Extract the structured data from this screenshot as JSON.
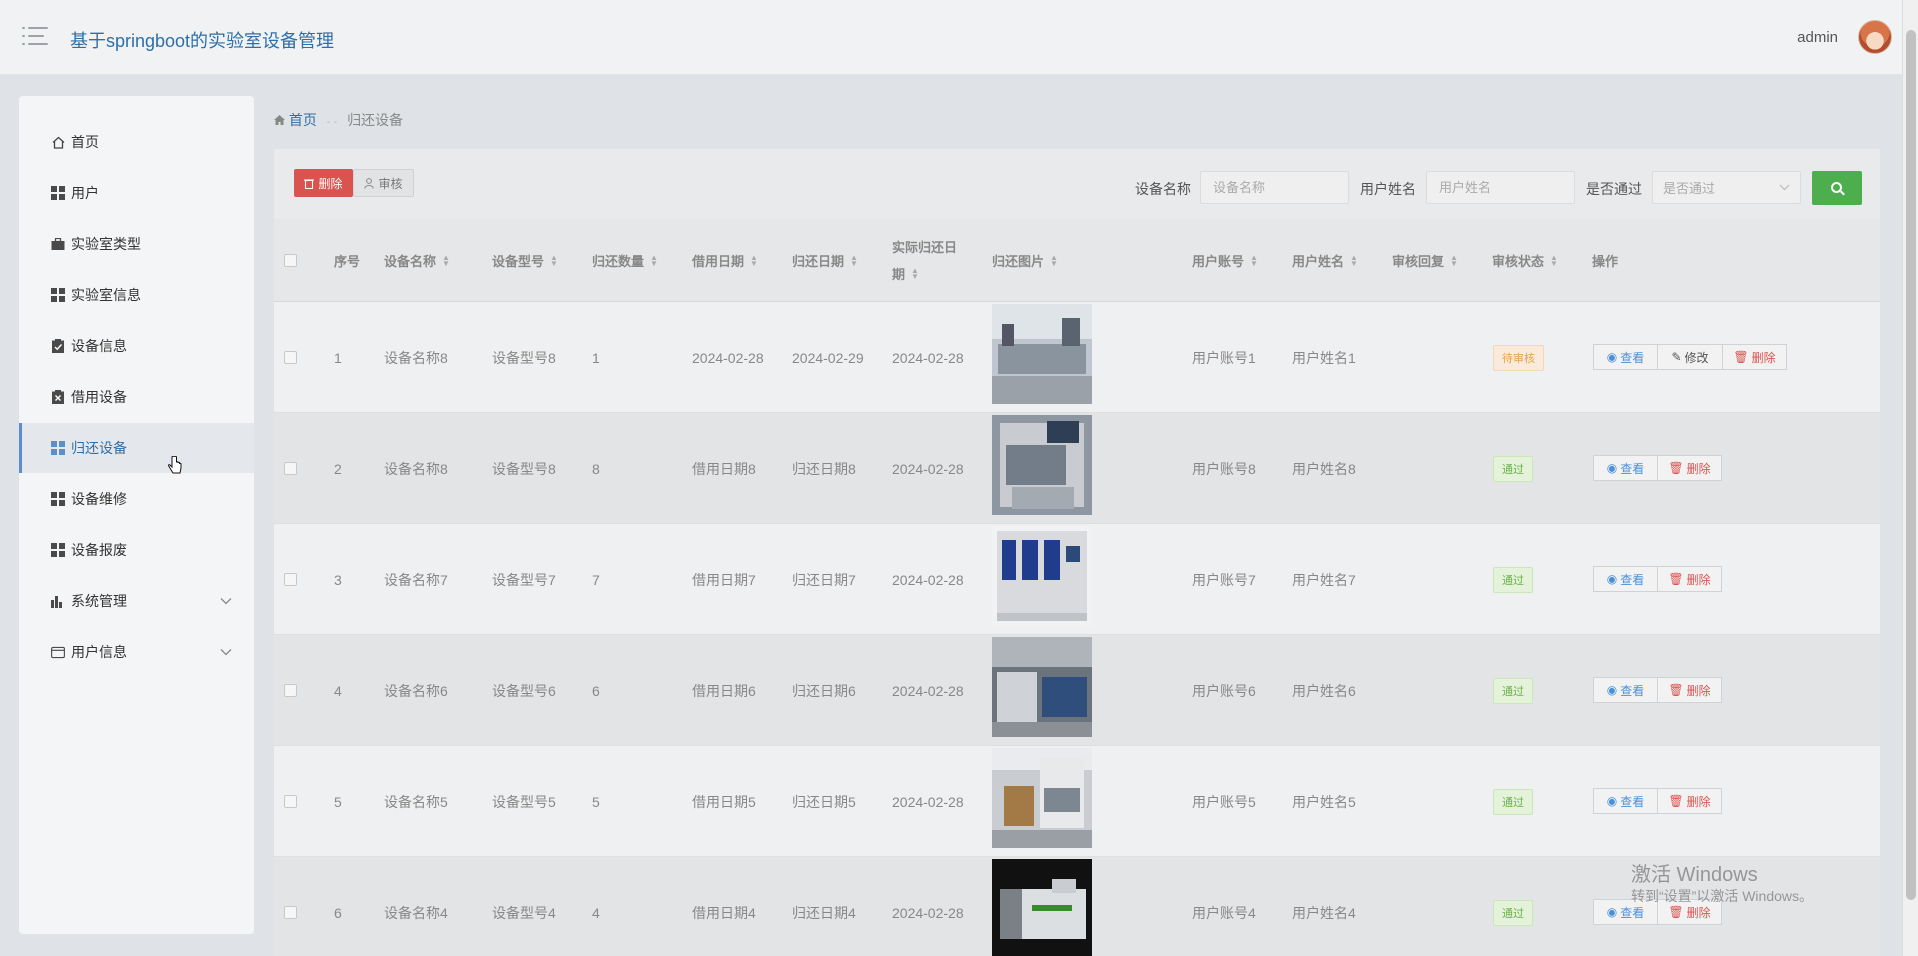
{
  "header": {
    "title": "基于springboot的实验室设备管理",
    "user": "admin"
  },
  "sidebar": {
    "items": [
      {
        "label": "首页",
        "icon": "home-icon"
      },
      {
        "label": "用户",
        "icon": "grid-icon"
      },
      {
        "label": "实验室类型",
        "icon": "briefcase-icon"
      },
      {
        "label": "实验室信息",
        "icon": "grid-icon"
      },
      {
        "label": "设备信息",
        "icon": "clipboard-check-icon"
      },
      {
        "label": "借用设备",
        "icon": "clipboard-x-icon"
      },
      {
        "label": "归还设备",
        "icon": "grid-icon"
      },
      {
        "label": "设备维修",
        "icon": "grid-icon"
      },
      {
        "label": "设备报废",
        "icon": "grid-icon"
      },
      {
        "label": "系统管理",
        "icon": "bar-chart-icon"
      },
      {
        "label": "用户信息",
        "icon": "card-icon"
      }
    ]
  },
  "breadcrumb": {
    "home": "首页",
    "sep": "- -",
    "current": "归还设备"
  },
  "toolbar": {
    "delete_label": "删除",
    "audit_label": "审核",
    "filters": {
      "device_name_label": "设备名称",
      "device_name_placeholder": "设备名称",
      "user_name_label": "用户姓名",
      "user_name_placeholder": "用户姓名",
      "passed_label": "是否通过",
      "passed_placeholder": "是否通过"
    }
  },
  "table": {
    "headers": {
      "seq": "序号",
      "name": "设备名称",
      "model": "设备型号",
      "qty": "归还数量",
      "borrow": "借用日期",
      "return": "归还日期",
      "actual_line1": "实际归还日",
      "actual_line2": "期",
      "image": "归还图片",
      "account": "用户账号",
      "user": "用户姓名",
      "reply": "审核回复",
      "status": "审核状态",
      "actions": "操作"
    },
    "rows": [
      {
        "seq": "1",
        "name": "设备名称8",
        "model": "设备型号8",
        "qty": "1",
        "borrow": "2024-02-28",
        "return": "2024-02-29",
        "actual": "2024-02-28",
        "account": "用户账号1",
        "user": "用户姓名1",
        "status": "待审核"
      },
      {
        "seq": "2",
        "name": "设备名称8",
        "model": "设备型号8",
        "qty": "8",
        "borrow": "借用日期8",
        "return": "归还日期8",
        "actual": "2024-02-28",
        "account": "用户账号8",
        "user": "用户姓名8",
        "status": "通过"
      },
      {
        "seq": "3",
        "name": "设备名称7",
        "model": "设备型号7",
        "qty": "7",
        "borrow": "借用日期7",
        "return": "归还日期7",
        "actual": "2024-02-28",
        "account": "用户账号7",
        "user": "用户姓名7",
        "status": "通过"
      },
      {
        "seq": "4",
        "name": "设备名称6",
        "model": "设备型号6",
        "qty": "6",
        "borrow": "借用日期6",
        "return": "归还日期6",
        "actual": "2024-02-28",
        "account": "用户账号6",
        "user": "用户姓名6",
        "status": "通过"
      },
      {
        "seq": "5",
        "name": "设备名称5",
        "model": "设备型号5",
        "qty": "5",
        "borrow": "借用日期5",
        "return": "归还日期5",
        "actual": "2024-02-28",
        "account": "用户账号5",
        "user": "用户姓名5",
        "status": "通过"
      },
      {
        "seq": "6",
        "name": "设备名称4",
        "model": "设备型号4",
        "qty": "4",
        "borrow": "借用日期4",
        "return": "归还日期4",
        "actual": "2024-02-28",
        "account": "用户账号4",
        "user": "用户姓名4",
        "status": "通过"
      }
    ],
    "actions": {
      "view": "查看",
      "edit": "修改",
      "remove": "删除"
    }
  },
  "watermark": {
    "line1": "激活 Windows",
    "line2": "转到“设置”以激活 Windows。"
  }
}
